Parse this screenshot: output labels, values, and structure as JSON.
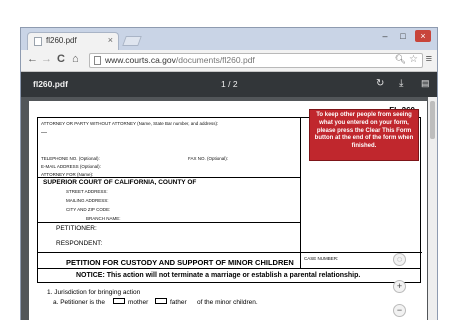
{
  "tab": {
    "title": "fl260.pdf",
    "close": "×"
  },
  "window_controls": {
    "minimize": "–",
    "maximize": "□",
    "close": "×"
  },
  "toolbar": {
    "back": "←",
    "forward": "→",
    "reload": "C",
    "home": "⌂",
    "url_host": "www.courts.ca.gov",
    "url_path": "/documents/fl260.pdf",
    "menu": "≡"
  },
  "pdf_toolbar": {
    "filename": "fl260.pdf",
    "page_current": "1",
    "page_sep": "/",
    "page_total": "2"
  },
  "form": {
    "form_number": "FL-260",
    "attorney_label": "ATTORNEY OR PARTY WITHOUT ATTORNEY (Name, State Bar number, and address):",
    "telephone_label": "TELEPHONE NO. (Optional):",
    "fax_label": "FAX NO. (Optional):",
    "email_label": "E-MAIL ADDRESS (Optional):",
    "attorney_for_label": "ATTORNEY FOR (Name):",
    "court_heading": "SUPERIOR COURT OF CALIFORNIA, COUNTY OF",
    "street_label": "STREET ADDRESS:",
    "mailing_label": "MAILING ADDRESS:",
    "city_label": "CITY AND ZIP CODE:",
    "branch_label": "BRANCH NAME:",
    "petitioner_label": "PETITIONER:",
    "respondent_label": "RESPONDENT:",
    "case_title": "PETITION FOR CUSTODY AND SUPPORT OF MINOR CHILDREN",
    "case_number_label": "CASE NUMBER:",
    "red_notice": "To keep other people from seeing what you entered on your form, please press the Clear This Form button at the end of the form when finished.",
    "notice": "NOTICE: This action will not terminate a marriage or establish a parental relationship.",
    "jurisdiction_heading": "1.   Jurisdiction for bringing action",
    "jurisdiction_a": "a.  Petitioner is the",
    "mother_label": "mother",
    "father_label": "father",
    "children_label": "of the minor children."
  },
  "icons": {
    "rotate": "rotate-icon",
    "download": "download-icon",
    "print": "print-icon",
    "fit": "fit-page-icon",
    "zoom_in": "zoom-in-icon",
    "zoom_out": "zoom-out-icon"
  }
}
